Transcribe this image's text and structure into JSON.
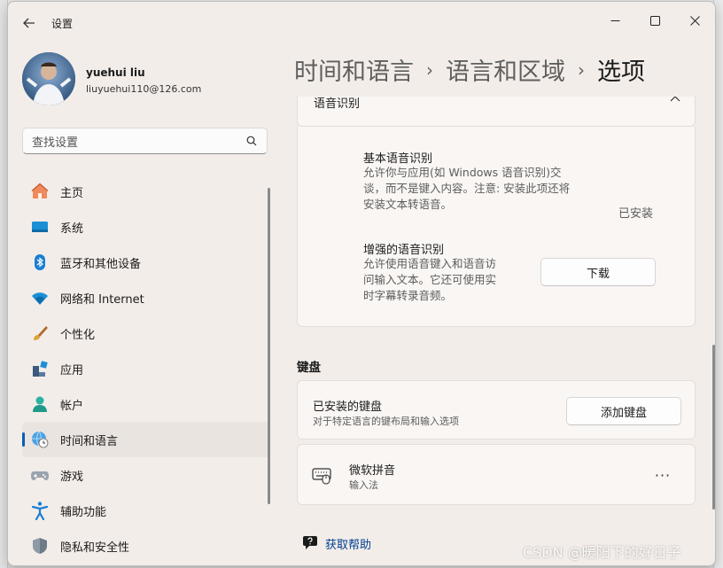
{
  "window": {
    "title": "设置"
  },
  "user": {
    "name": "yuehui liu",
    "email": "liuyuehui110@126.com"
  },
  "search": {
    "placeholder": "查找设置"
  },
  "sidebar": {
    "items": [
      {
        "label": "主页",
        "icon": "home-icon",
        "active": false
      },
      {
        "label": "系统",
        "icon": "system-monitor-icon",
        "active": false
      },
      {
        "label": "蓝牙和其他设备",
        "icon": "bluetooth-icon",
        "active": false
      },
      {
        "label": "网络和 Internet",
        "icon": "wifi-icon",
        "active": false
      },
      {
        "label": "个性化",
        "icon": "paintbrush-icon",
        "active": false
      },
      {
        "label": "应用",
        "icon": "apps-icon",
        "active": false
      },
      {
        "label": "帐户",
        "icon": "account-icon",
        "active": false
      },
      {
        "label": "时间和语言",
        "icon": "globe-clock-icon",
        "active": true
      },
      {
        "label": "游戏",
        "icon": "gamepad-icon",
        "active": false
      },
      {
        "label": "辅助功能",
        "icon": "accessibility-icon",
        "active": false
      },
      {
        "label": "隐私和安全性",
        "icon": "shield-icon",
        "active": false
      }
    ]
  },
  "breadcrumb": {
    "level1": "时间和语言",
    "level2": "语言和区域",
    "current": "选项",
    "separator": "›"
  },
  "speech": {
    "header": "语音识别",
    "basic": {
      "title": "基本语音识别",
      "desc_lines": [
        "允许你与应用(如 Windows 语音识别)交",
        "谈，而不是键入内容。注意: 安装此项还将",
        "安装文本转语音。"
      ],
      "status": "已安装"
    },
    "enhanced": {
      "title": "增强的语音识别",
      "desc_lines": [
        "允许使用语音键入和语音访",
        "问输入文本。它还可使用实",
        "时字幕转录音频。"
      ],
      "button": "下载"
    }
  },
  "keyboard": {
    "section_title": "键盘",
    "installed_title": "已安装的键盘",
    "installed_sub": "对于特定语言的键布局和输入选项",
    "add_button": "添加键盘",
    "ime_name": "微软拼音",
    "ime_type": "输入法",
    "more": "···"
  },
  "help": {
    "label": "获取帮助"
  },
  "watermark": "CSDN @暖阳下的好日子",
  "colors": {
    "accent": "#005fb8",
    "link": "#003e92",
    "window_bg": "#f3ede9",
    "card_bg": "#f9f6f4"
  }
}
